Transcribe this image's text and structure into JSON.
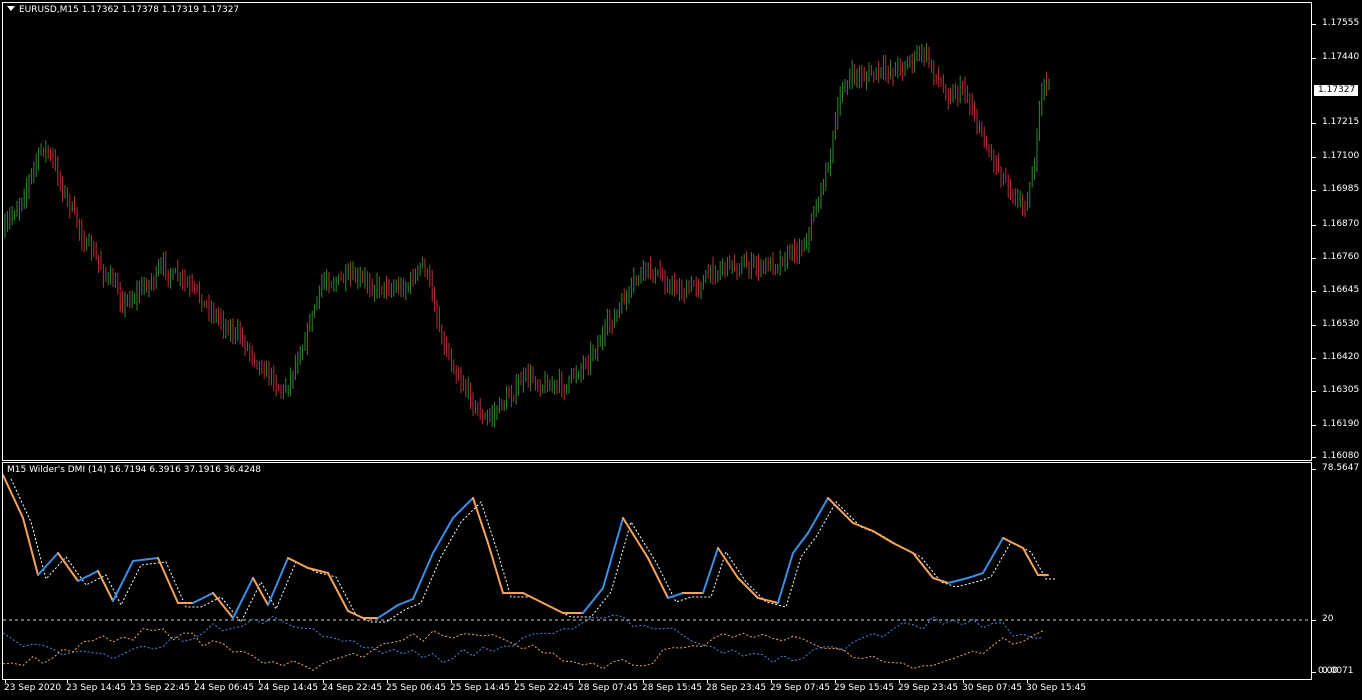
{
  "main_title": "EURUSD,M15  1.17362 1.17378 1.17319 1.17327",
  "indicator_title": "M15 Wilder's DMI (14) 16.7194 6.3916 37.1916 36.4248",
  "price_levels": [
    "1.17555",
    "1.17440",
    "1.17215",
    "1.17100",
    "1.16985",
    "1.16870",
    "1.16760",
    "1.16645",
    "1.16530",
    "1.16420",
    "1.16305",
    "1.16190",
    "1.16080"
  ],
  "current_price": "1.17327",
  "indicator_levels": {
    "top": "78.5647",
    "mid": "20",
    "bottom": "0.0071",
    "bottom_overlap": "0.00"
  },
  "time_labels": [
    "23 Sep 2020",
    "23 Sep 14:45",
    "23 Sep 22:45",
    "24 Sep 06:45",
    "24 Sep 14:45",
    "24 Sep 22:45",
    "25 Sep 06:45",
    "25 Sep 14:45",
    "25 Sep 22:45",
    "28 Sep 07:45",
    "28 Sep 15:45",
    "28 Sep 23:45",
    "29 Sep 07:45",
    "29 Sep 15:45",
    "29 Sep 23:45",
    "30 Sep 07:45",
    "30 Sep 15:45"
  ],
  "colors": {
    "bull": "#2e8b2e",
    "bear": "#b83232",
    "adx_up": "#3a8ee6",
    "adx_down": "#f5a35c",
    "adxr": "#ffffff"
  }
}
